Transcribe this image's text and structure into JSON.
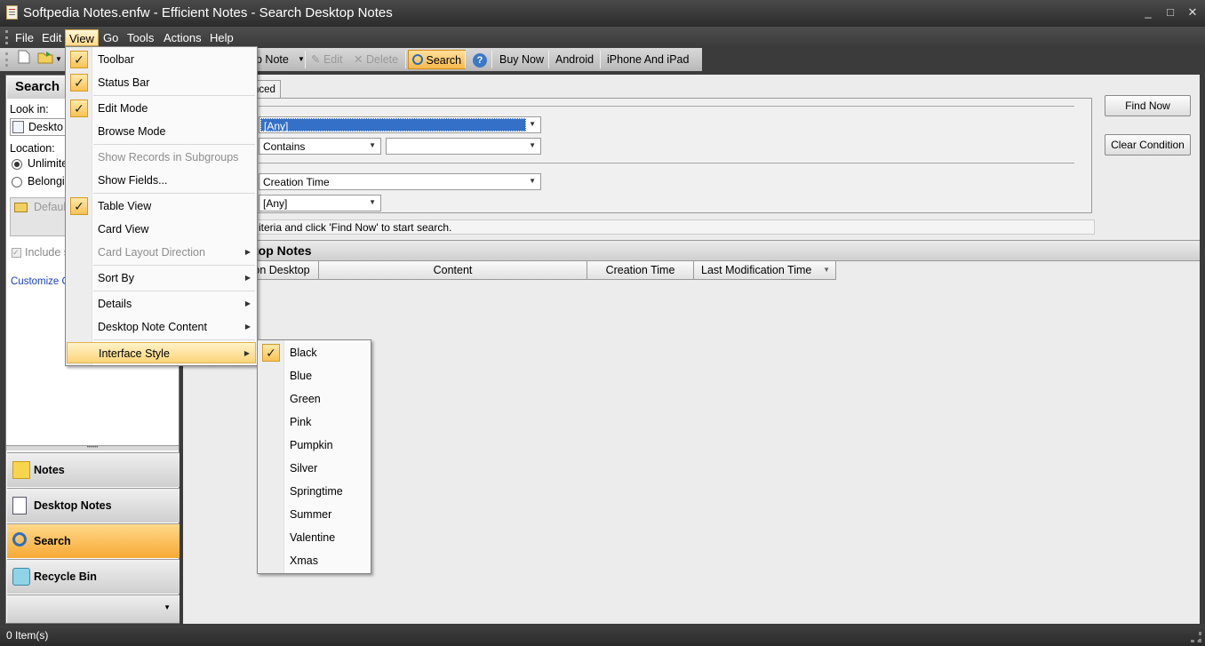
{
  "window": {
    "title": "Softpedia Notes.enfw - Efficient Notes - Search Desktop Notes",
    "minimize": "_",
    "maximize": "□",
    "close": "✕"
  },
  "menubar": {
    "items": [
      "File",
      "Edit",
      "View",
      "Go",
      "Tools",
      "Actions",
      "Help"
    ]
  },
  "toolbar": {
    "new_note_partial": "p Note",
    "edit": "Edit",
    "delete": "Delete",
    "search": "Search",
    "buy_now": "Buy Now",
    "android": "Android",
    "iphone": "iPhone And iPad"
  },
  "left": {
    "header": "Search",
    "look_in_label": "Look in:",
    "look_in_value": "Deskto",
    "location_label": "Location:",
    "radio_unlimited": "Unlimite",
    "radio_belonging": "Belongin",
    "folder_text": "Default",
    "include_label": "Include s",
    "customize_link": "Customize Cu",
    "nav": {
      "notes": "Notes",
      "desktop_notes": "Desktop Notes",
      "search": "Search",
      "recycle_bin": "Recycle Bin"
    }
  },
  "main": {
    "tab_partial": "nced",
    "combo_any_1": "[Any]",
    "combo_contains": "Contains",
    "combo_value": "",
    "combo_creation": "Creation Time",
    "combo_any_2": "[Any]",
    "find_now": "Find Now",
    "clear_condition": "Clear Condition",
    "info_partial": "iteria and click 'Find Now' to start search.",
    "grid_title_partial": "top Notes",
    "columns": [
      "on Desktop",
      "Content",
      "Creation Time",
      "Last Modification Time"
    ]
  },
  "view_menu": {
    "items": [
      {
        "label": "Toolbar",
        "checked": true
      },
      {
        "label": "Status Bar",
        "checked": true
      },
      {
        "label": "Edit Mode",
        "checked": true
      },
      {
        "label": "Browse Mode",
        "checked": false
      },
      {
        "label": "Show Records in Subgroups",
        "disabled": true
      },
      {
        "label": "Show Fields...",
        "checked": false
      },
      {
        "label": "Table View",
        "checked": true
      },
      {
        "label": "Card View",
        "checked": false
      },
      {
        "label": "Card Layout Direction",
        "disabled": true,
        "submenu": true
      },
      {
        "label": "Sort By",
        "submenu": true
      },
      {
        "label": "Details",
        "submenu": true
      },
      {
        "label": "Desktop Note Content",
        "submenu": true
      },
      {
        "label": "Interface Style",
        "submenu": true,
        "hover": true
      }
    ]
  },
  "style_menu": {
    "items": [
      "Black",
      "Blue",
      "Green",
      "Pink",
      "Pumpkin",
      "Silver",
      "Springtime",
      "Summer",
      "Valentine",
      "Xmas"
    ],
    "selected": "Black"
  },
  "status": {
    "items_count": "0 Item(s)"
  }
}
